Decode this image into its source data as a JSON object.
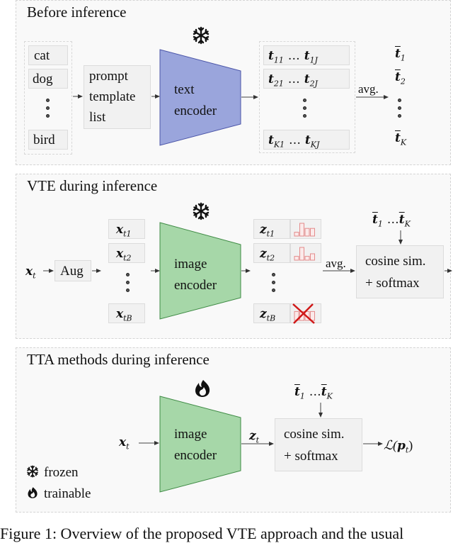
{
  "panels": {
    "before": {
      "title": "Before inference",
      "classes": [
        "cat",
        "dog",
        "bird"
      ],
      "template_box": [
        "prompt",
        "template",
        "list"
      ],
      "encoder": [
        "text",
        "encoder"
      ],
      "encoder_state_icon": "snowflake-icon",
      "embeddings_rows": [
        {
          "first": "t",
          "first_sub": "11",
          "last": "t",
          "last_sub": "1J"
        },
        {
          "first": "t",
          "first_sub": "21",
          "last": "t",
          "last_sub": "2J"
        },
        {
          "first": "t",
          "first_sub": "K1",
          "last": "t",
          "last_sub": "KJ"
        }
      ],
      "avg_label": "avg.",
      "outputs": [
        {
          "sym": "t",
          "sub": "1"
        },
        {
          "sym": "t",
          "sub": "2"
        },
        {
          "sym": "t",
          "sub": "K"
        }
      ],
      "ellipsis": "…"
    },
    "vte": {
      "title": "VTE during inference",
      "input": {
        "sym": "x",
        "sub": "t"
      },
      "aug_label": "Aug",
      "augmented": [
        {
          "sym": "x",
          "sub": "t1"
        },
        {
          "sym": "x",
          "sub": "t2"
        },
        {
          "sym": "x",
          "sub": "tB"
        }
      ],
      "encoder": [
        "image",
        "encoder"
      ],
      "encoder_state_icon": "snowflake-icon",
      "features": [
        {
          "sym": "z",
          "sub": "t1",
          "hist": [
            0.3,
            1.0,
            0.6,
            0.6
          ],
          "filtered": false
        },
        {
          "sym": "z",
          "sub": "t2",
          "hist": [
            0.3,
            1.0,
            0.3,
            0.5
          ],
          "filtered": false
        },
        {
          "sym": "z",
          "sub": "tB",
          "hist": [
            0.7,
            0.7,
            0.7,
            0.7
          ],
          "filtered": true
        }
      ],
      "avg_label": "avg.",
      "text_inputs": {
        "first": "t",
        "first_sub": "1",
        "last": "t",
        "last_sub": "K",
        "ellipsis": "…"
      },
      "sim_box": [
        "cosine sim.",
        "+ softmax"
      ],
      "accent_red": "#e05050"
    },
    "tta": {
      "title": "TTA methods during inference",
      "input": {
        "sym": "x",
        "sub": "t"
      },
      "encoder": [
        "image",
        "encoder"
      ],
      "encoder_state_icon": "flame-icon",
      "feature": {
        "sym": "z",
        "sub": "t"
      },
      "text_inputs": {
        "first": "t",
        "first_sub": "1",
        "last": "t",
        "last_sub": "K",
        "ellipsis": "…"
      },
      "sim_box": [
        "cosine sim.",
        "+ softmax"
      ],
      "loss": {
        "script": "ℒ(",
        "sym": "p",
        "sub": "t",
        "close": ")"
      },
      "legend": [
        {
          "icon": "snowflake-icon",
          "label": "frozen"
        },
        {
          "icon": "flame-icon",
          "label": "trainable"
        }
      ]
    }
  },
  "colors": {
    "text_encoder_fill": "#9aa5dc",
    "text_encoder_stroke": "#4b55a8",
    "image_encoder_fill": "#a6d7a8",
    "image_encoder_stroke": "#3f8b45",
    "hist_red": "#e48b8b",
    "cross_red": "#d01818"
  },
  "caption_partial": "Figure 1: Overview of the proposed VTE approach and the usual"
}
